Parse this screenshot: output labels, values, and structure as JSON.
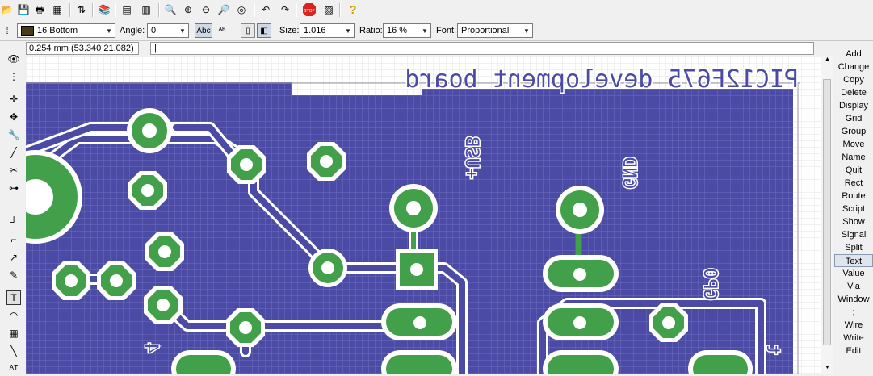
{
  "colors": {
    "board_fill": "#4b4ba6",
    "grid_line": "#6c6cbf",
    "copper_pad": "#43a04a",
    "highlight": "#ffff00"
  },
  "toolbar": {
    "icons": [
      "open-icon",
      "save-icon",
      "print-icon",
      "cam-processor-icon",
      "script-icon",
      "library-icon",
      "schematic-icon",
      "board-icon",
      "zoom-fit-icon",
      "zoom-in-icon",
      "zoom-out-icon",
      "zoom-select-icon",
      "redraw-icon",
      "undo-icon",
      "redo-icon",
      "stop-icon",
      "go-icon",
      "help-icon"
    ]
  },
  "params": {
    "layer": "16 Bottom",
    "angle_label": "Angle:",
    "angle": "0",
    "size_label": "Size:",
    "size": "1.016",
    "ratio_label": "Ratio:",
    "ratio": "16 %",
    "font_label": "Font:",
    "font": "Proportional"
  },
  "coordinates": "0.254 mm (53.340 21.082)",
  "command_line": "|",
  "canvas_text": {
    "title": "PIC12F675 development board",
    "usb": "+USB",
    "gnd": "GND",
    "gp0": "GP0",
    "label_4": "4",
    "label_t": "t"
  },
  "commands": [
    "Add",
    "Change",
    "Copy",
    "Delete",
    "Display",
    "Grid",
    "Group",
    "Move",
    "Name",
    "Quit",
    "Rect",
    "Route",
    "Script",
    "Show",
    "Signal",
    "Split",
    "Text",
    "Value",
    "Via",
    "Window",
    ";",
    "Wire",
    "Write",
    "Edit"
  ],
  "active_command": "Text",
  "tools": [
    "info-icon",
    "show-icon",
    "mark-icon",
    "move-tool-icon",
    "copy-tool-icon",
    "mirror-icon",
    "rotate-icon",
    "wire-icon",
    "text-icon",
    "circle-icon",
    "arc-icon",
    "rect-icon",
    "polygon-icon",
    "via-icon",
    "hole-icon",
    "attribute-icon"
  ]
}
